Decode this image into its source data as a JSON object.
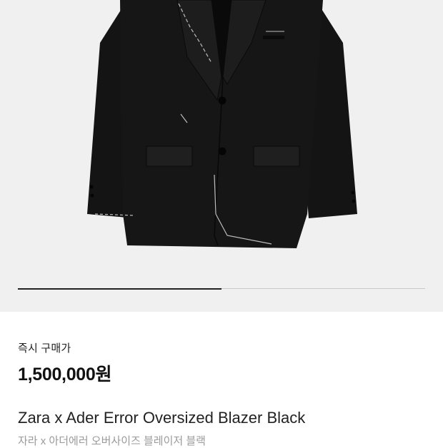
{
  "product": {
    "image_icon": "blazer-photo",
    "image_pager_progress": 0.5,
    "price_label": "즉시 구매가",
    "price": "1,500,000원",
    "title": "Zara x Ader Error Oversized Blazer Black",
    "subtitle": "자라 x 아더에러 오버사이즈 블레이저 블랙"
  },
  "colors": {
    "image_bg": "#f0f0f0",
    "blazer": "#121212",
    "text_primary": "#111111",
    "text_secondary": "#9a9a9a"
  }
}
